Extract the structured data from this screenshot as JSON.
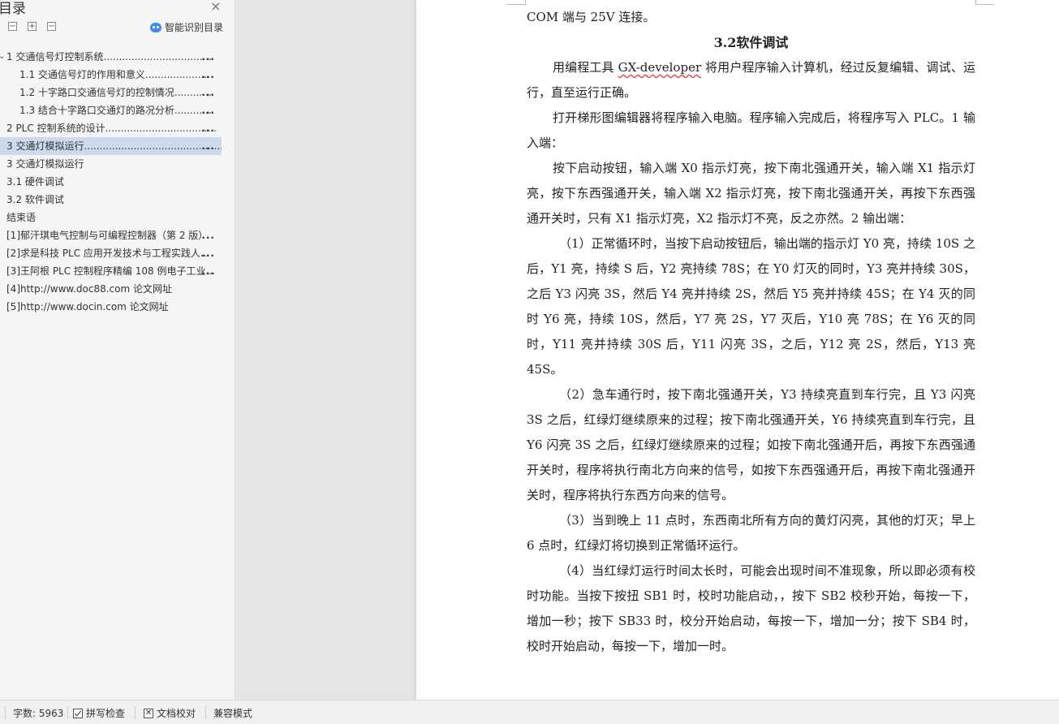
{
  "sidebar": {
    "title": "目录",
    "close": "×",
    "tools": {
      "collapse": "−",
      "expand": "+",
      "remove": "−"
    },
    "smart_toc": "智能识别目录",
    "items": [
      {
        "label": "1 交通信号灯控制系统...................................",
        "ell": "...",
        "level": 1,
        "caret": "⌄"
      },
      {
        "label": "1.1 交通信号灯的作用和意义.....................",
        "ell": "...",
        "level": 2
      },
      {
        "label": "1.2 十字路口交通信号灯的控制情况............",
        "ell": "...",
        "level": 2
      },
      {
        "label": "1.3 结合十字路口交通灯的路况分析............",
        "ell": "...",
        "level": 2
      },
      {
        "label": "2 PLC 控制系统的设计....................................",
        "ell": "...",
        "level": 1
      },
      {
        "label": "3 交通灯模拟运行...............................................",
        "ell": "...",
        "level": 1,
        "selected": true
      },
      {
        "label": "3 交通灯模拟运行",
        "level": 1
      },
      {
        "label": "3.1 硬件调试",
        "level": 1
      },
      {
        "label": "3.2 软件调试",
        "level": 1
      },
      {
        "label": "结束语",
        "level": 1
      },
      {
        "label": "[1]郁汗琪电气控制与可编程控制器（第 2 版）",
        "ell": "...",
        "level": 1
      },
      {
        "label": "[2]求是科技 PLC 应用开发技术与工程实践人...",
        "ell": "...",
        "level": 1
      },
      {
        "label": "[3]王阿根 PLC 控制程序精编 108 例电子工业...",
        "ell": "...",
        "level": 1
      },
      {
        "label": "[4]http://www.doc88.com 论文网址",
        "level": 1
      },
      {
        "label": "[5]http://www.docin.com 论文网址",
        "level": 1
      }
    ]
  },
  "document": {
    "line0": "COM 端与 25V 连接。",
    "heading": "3.2软件调试",
    "p1_a": "用编程工具 ",
    "p1_u": "GX-developer",
    "p1_b": " 将用户程序输入计算机，经过反复编辑、调试、运行，直至运行正确。",
    "p2": "打开梯形图编辑器将程序输入电脑。程序输入完成后，将程序写入 PLC。1 输入端：",
    "p3": "按下启动按钮，输入端 X0 指示灯亮，按下南北强通开关，输入端 X1 指示灯亮，按下东西强通开关，输入端 X2 指示灯亮，按下南北强通开关，再按下东西强通开关时，只有 X1 指示灯亮，X2 指示灯不亮，反之亦然。2 输出端：",
    "p4": "（1）正常循环时，当按下启动按钮后，输出端的指示灯 Y0 亮，持续 10S 之后，Y1 亮，持续 S 后，Y2 亮持续 78S；在 Y0 灯灭的同时，Y3 亮并持续 30S，之后 Y3 闪亮 3S，然后 Y4 亮并持续 2S，然后 Y5 亮并持续 45S；在 Y4 灭的同时 Y6 亮，持续 10S，然后，Y7 亮 2S，Y7 灭后，Y10 亮 78S；在 Y6 灭的同时，Y11 亮并持续 30S 后，Y11 闪亮 3S，之后，Y12 亮 2S，然后，Y13 亮 45S。",
    "p5": "（2）急车通行时，按下南北强通开关，Y3 持续亮直到车行完，且 Y3 闪亮 3S 之后，红绿灯继续原来的过程；按下南北强通开关，Y6 持续亮直到车行完，且 Y6 闪亮 3S 之后，红绿灯继续原来的过程；如按下南北强通开后，再按下东西强通开关时，程序将执行南北方向来的信号，如按下东西强通开后，再按下南北强通开关时，程序将执行东西方向来的信号。",
    "p6": "（3）当到晚上 11 点时，东西南北所有方向的黄灯闪亮，其他的灯灭；早上 6 点时，红绿灯将切换到正常循环运行。",
    "p7": "（4）当红绿灯运行时间太长时，可能会出现时间不准现象，所以即必须有校时功能。当按下按扭 SB1 时，校时功能启动，，按下 SB2 校秒开始，每按一下，增加一秒；按下 SB33 时，校分开始启动，每按一下，增加一分；按下 SB4 时，校时开始启动，每按一下，增加一时。"
  },
  "statusbar": {
    "word_count": "字数: 5963",
    "spell_check": "拼写检查",
    "doc_proof": "文档校对",
    "compat_mode": "兼容模式"
  }
}
